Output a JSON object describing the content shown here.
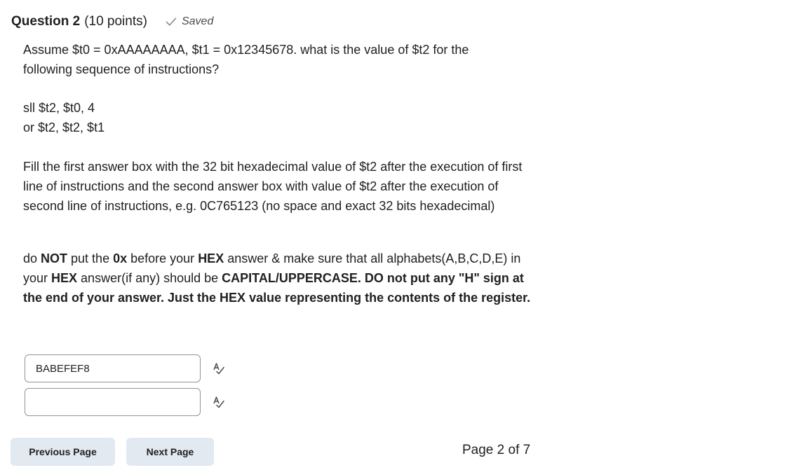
{
  "question": {
    "title": "Question 2",
    "points": "(10 points)",
    "saved_label": "Saved"
  },
  "prompt": {
    "intro_line1": "Assume $t0 = 0xAAAAAAAA, $t1 = 0x12345678. what is the value of $t2 for the",
    "intro_line2": "following sequence of instructions?",
    "instruction1": "sll $t2, $t0, 4",
    "instruction2": "or $t2, $t2, $t1",
    "fill_text": "Fill the first answer box with the 32 bit hexadecimal value of $t2 after the execution of first line of instructions and the second answer box with value of $t2 after the execution of second line of instructions, e.g. 0C765123 (no space and exact 32 bits hexadecimal)",
    "note": {
      "s1": "do ",
      "s2": "NOT",
      "s3": " put the ",
      "s4": "0x",
      "s5": " before your ",
      "s6": "HEX",
      "s7": " answer & make sure that all alphabets(A,B,C,D,E) in your ",
      "s8": "HEX",
      "s9": " answer(if any) should be ",
      "s10": "CAPITAL/UPPERCASE. DO not put any \"H\" sign at the end of your answer. Just the HEX value representing the contents of the register."
    }
  },
  "answers": {
    "first_value": "BABEFEF8",
    "second_value": ""
  },
  "icons": {
    "saved": "checkmark-icon",
    "spellcheck": "spellcheck-icon"
  },
  "nav": {
    "previous_label": "Previous Page",
    "next_label": "Next Page",
    "page_indicator": "Page 2 of 7"
  },
  "colors": {
    "button_bg": "#e3e9f1",
    "text": "#202122",
    "muted": "#494c4e",
    "border": "#909396"
  }
}
